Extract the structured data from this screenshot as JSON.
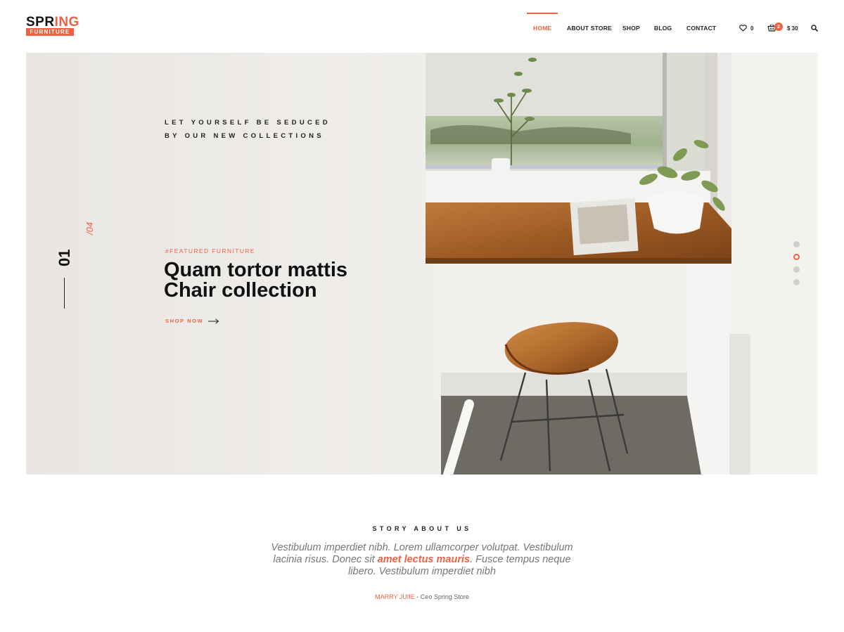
{
  "brand": {
    "logo_part1": "SPR",
    "logo_part2": "ING",
    "logo_sub": "FURNITURE",
    "accent_color": "#ef6143"
  },
  "nav": {
    "items": [
      {
        "label": "HOME",
        "active": true
      },
      {
        "label": "ABOUT STORE",
        "active": false
      },
      {
        "label": "SHOP",
        "active": false
      },
      {
        "label": "BLOG",
        "active": false
      },
      {
        "label": "CONTACT",
        "active": false
      }
    ]
  },
  "header_icons": {
    "wishlist_icon": "heart-icon",
    "wishlist_count": "0",
    "cart_icon": "basket-icon",
    "cart_count": "2",
    "cart_total": "$ 30",
    "search_icon": "search-icon"
  },
  "hero": {
    "tagline_line1": "LET YOURSELF BE SEDUCED",
    "tagline_line2": "BY OUR NEW COLLECTIONS",
    "featured": "#FEATURED FURNITURE",
    "title_line1": "Quam tortor mattis",
    "title_line2": "Chair collection",
    "cta": "SHOP NOW",
    "slide_current": "01",
    "slide_total": "/04",
    "dots": [
      false,
      true,
      false,
      false
    ]
  },
  "story": {
    "title": "STORY ABOUT US",
    "text_before": "Vestibulum imperdiet nibh. Lorem  ullamcorper volutpat. Vestibulum lacinia risus. Donec sit ",
    "text_highlight": "amet lectus mauris",
    "text_after": ". Fusce tempus neque libero. Vestibulum imperdiet nibh",
    "author_name": "MARRY JUIIE",
    "author_role": " - Ceo Spring Store"
  }
}
